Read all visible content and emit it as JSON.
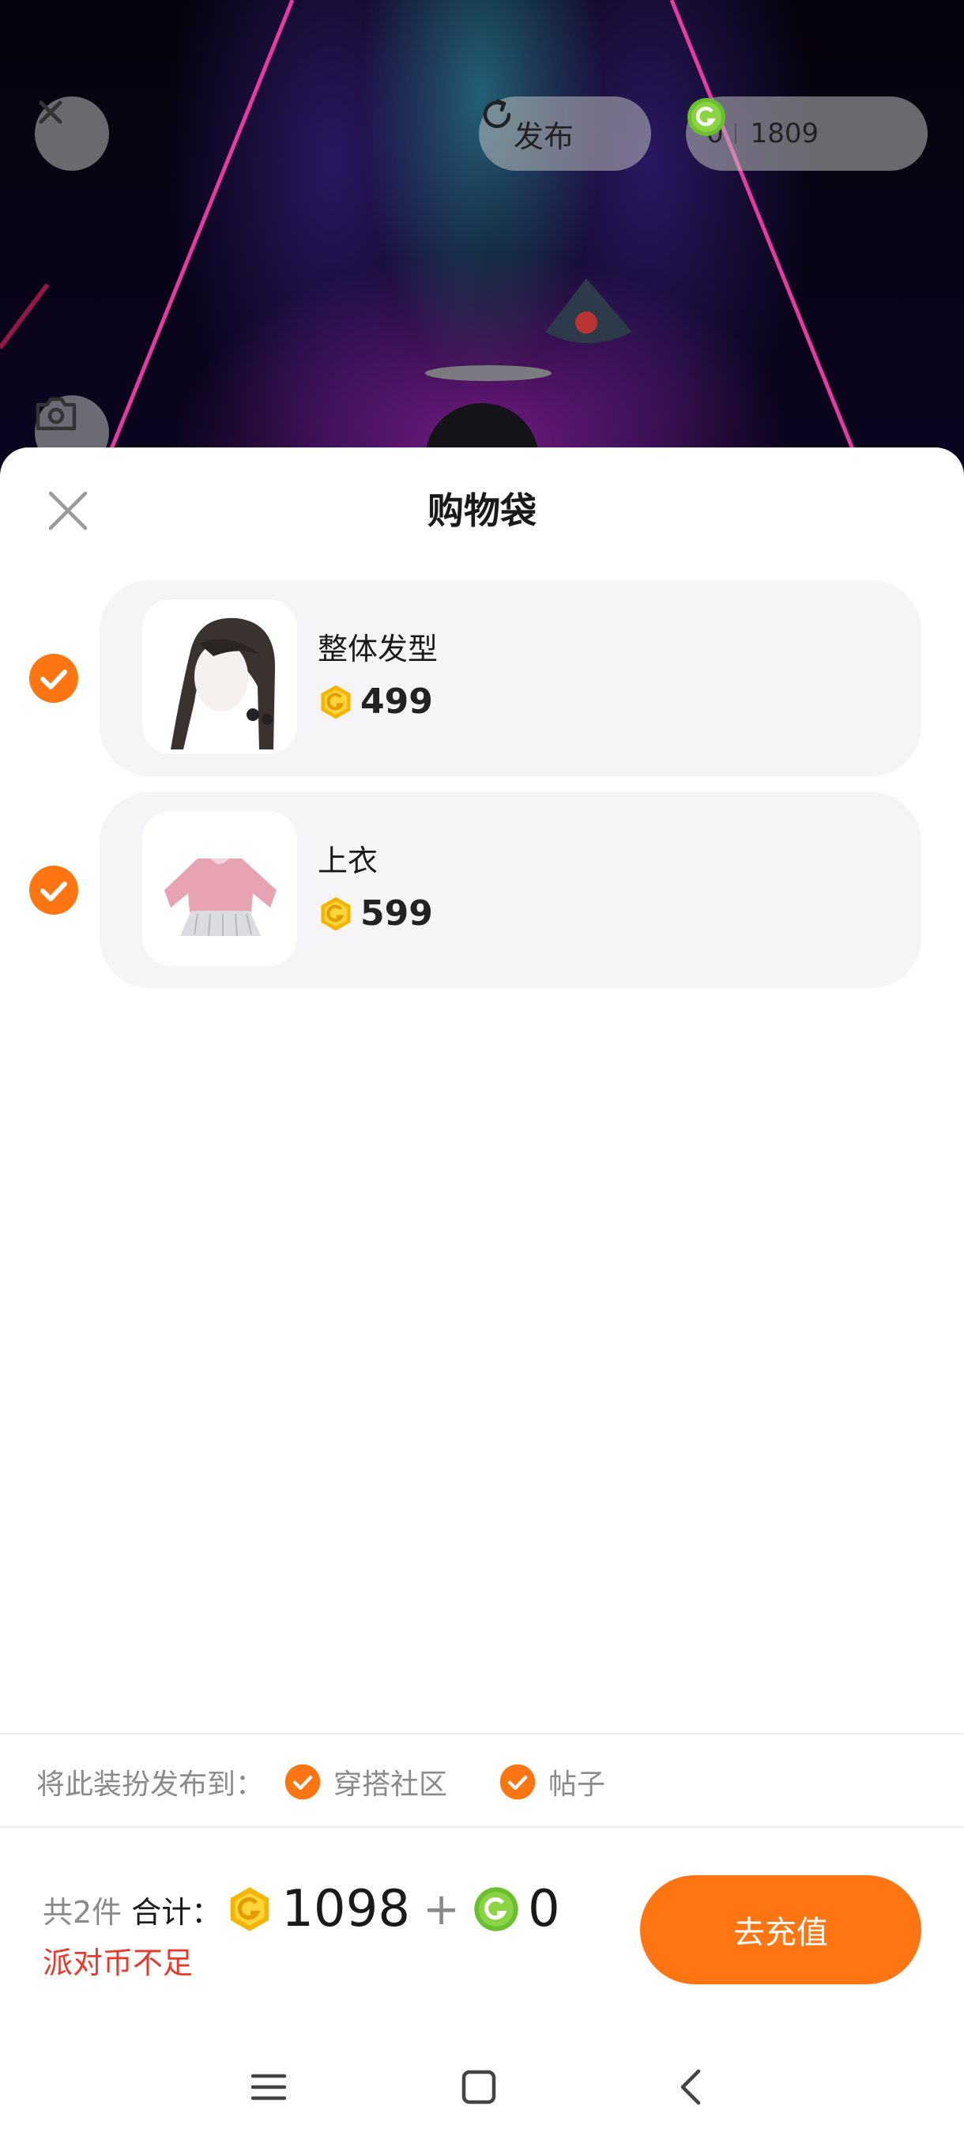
{
  "scene": {
    "publish_label": "发布",
    "gold_coin_balance": "0",
    "green_coin_balance": "1809"
  },
  "sheet": {
    "title": "购物袋",
    "items": [
      {
        "name": "整体发型",
        "price": "499",
        "checked": true
      },
      {
        "name": "上衣",
        "price": "599",
        "checked": true
      }
    ],
    "publish_to": {
      "label": "将此装扮发布到：",
      "options": [
        {
          "label": "穿搭社区",
          "checked": true
        },
        {
          "label": "帖子",
          "checked": true
        }
      ]
    },
    "summary": {
      "count": "共2件",
      "total_label": "合计：",
      "gold_total": "1098",
      "plus": "+",
      "green_total": "0",
      "warning": "派对币不足"
    },
    "recharge_button": "去充值"
  },
  "colors": {
    "accent_orange": "#ff7512",
    "gold_coin": "#f5b400",
    "green_coin": "#6abf2e",
    "warning_red": "#e8392a"
  },
  "icons": [
    "close-icon",
    "refresh-icon",
    "gold-coin-icon",
    "green-coin-icon",
    "camera-icon",
    "check-icon",
    "menu-icon",
    "home-icon",
    "back-icon"
  ]
}
